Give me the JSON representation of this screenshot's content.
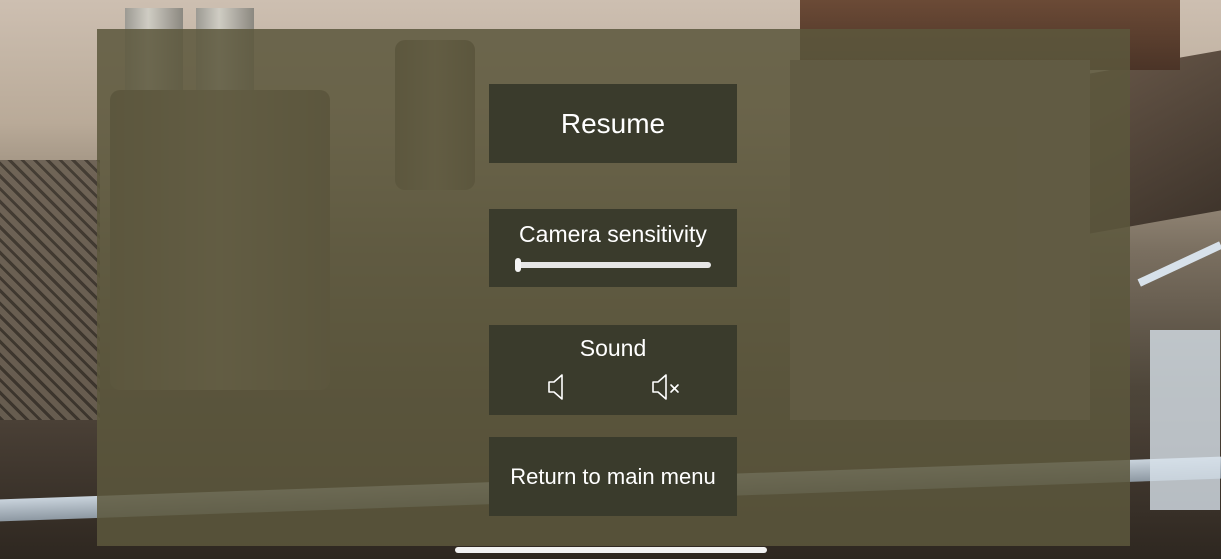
{
  "pause_menu": {
    "resume_label": "Resume",
    "camera_sensitivity": {
      "label": "Camera sensitivity",
      "value_fraction": 0.0
    },
    "sound": {
      "label": "Sound",
      "icons": [
        "speaker-icon",
        "speaker-muted-icon"
      ]
    },
    "return_label": "Return to main menu"
  },
  "colors": {
    "overlay": "#5c573c",
    "button_bg": "#3a3b2c",
    "text": "#ffffff"
  }
}
